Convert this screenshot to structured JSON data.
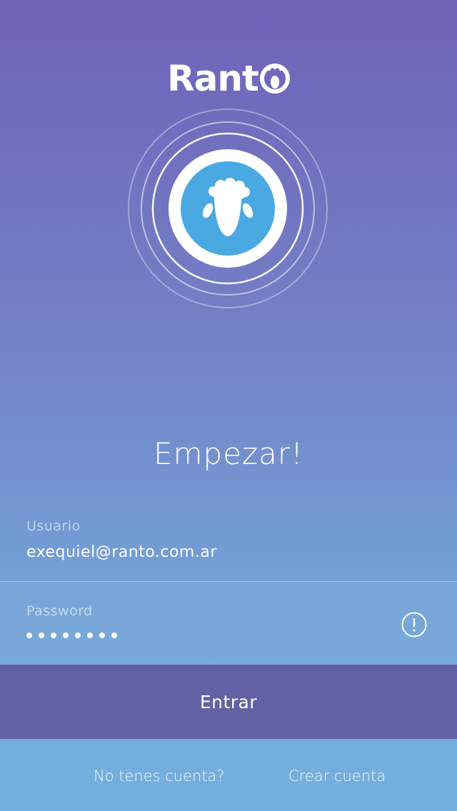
{
  "app": {
    "name_prefix": "Rant",
    "logo_icon": "sheep-o-icon"
  },
  "hero": {
    "icon": "sheep-icon",
    "accent": "#4aa9e1"
  },
  "headline": "Empezar!",
  "form": {
    "username": {
      "label": "Usuario",
      "value": "exequiel@ranto.com.ar"
    },
    "password": {
      "label": "Password",
      "mask_count": 8,
      "warning_icon": "alert-circle-icon"
    }
  },
  "actions": {
    "submit_label": "Entrar"
  },
  "footer": {
    "question": "No tenes cuenta?",
    "create_label": "Crear cuenta"
  },
  "colors": {
    "button_bg": "#6460a4",
    "footer_bg": "#74aedd",
    "bg_top": "#6f62b8",
    "bg_bottom": "#74aedd"
  }
}
